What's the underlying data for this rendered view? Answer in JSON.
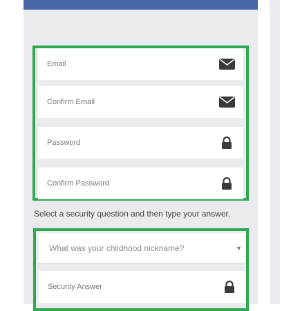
{
  "account_fields": [
    {
      "label": "Email",
      "icon": "envelope-icon"
    },
    {
      "label": "Confirm Email",
      "icon": "envelope-icon"
    },
    {
      "label": "Password",
      "icon": "lock-icon"
    },
    {
      "label": "Confirm Password",
      "icon": "lock-icon"
    }
  ],
  "security": {
    "instruction": "Select a security question and then type your answer.",
    "question_selected": "What was your childhood nickname?",
    "answer_placeholder": "Security Answer"
  },
  "colors": {
    "highlight_border": "#2fa84f",
    "top_bar": "#4a67a8",
    "panel_bg": "#e9ebee"
  }
}
